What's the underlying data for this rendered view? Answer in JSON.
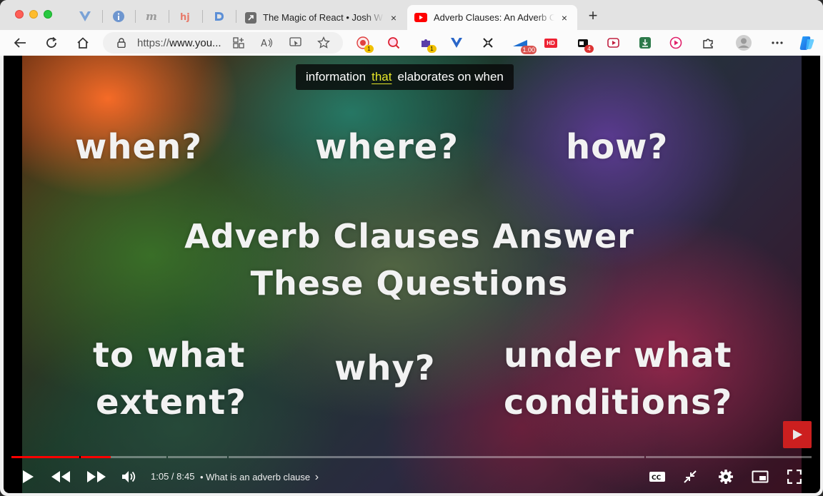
{
  "browser": {
    "tabs": [
      {
        "title": "The Magic of React • Josh W Comeau",
        "close": "×",
        "active": false
      },
      {
        "title": "Adverb Clauses: An Adverb Clause",
        "close": "×",
        "active": true
      }
    ],
    "new_tab": "+",
    "url_scheme": "https://",
    "url_host": "www.you...",
    "extension_badges": {
      "ext1": "1",
      "ext3": "1",
      "speed": "1.00",
      "hd": "HD",
      "ext_count": "4"
    }
  },
  "video": {
    "caption": {
      "before": "information",
      "highlight": "that",
      "after": "elaborates on when"
    },
    "questions": {
      "when": "when?",
      "where": "where?",
      "how": "how?",
      "to_what_1": "to what",
      "to_what_2": "extent?",
      "why": "why?",
      "under_1": "under what",
      "under_2": "conditions?"
    },
    "headline_1": "Adverb Clauses Answer",
    "headline_2": "These Questions",
    "progress_fraction": 0.124,
    "time": "1:05 / 8:45",
    "chapter": "• What is an adverb clause",
    "chapter_arrow": "›",
    "colors": {
      "played": "#ff0000",
      "accent_caption": "#e6e628",
      "logo": "#cc1f1f"
    }
  }
}
